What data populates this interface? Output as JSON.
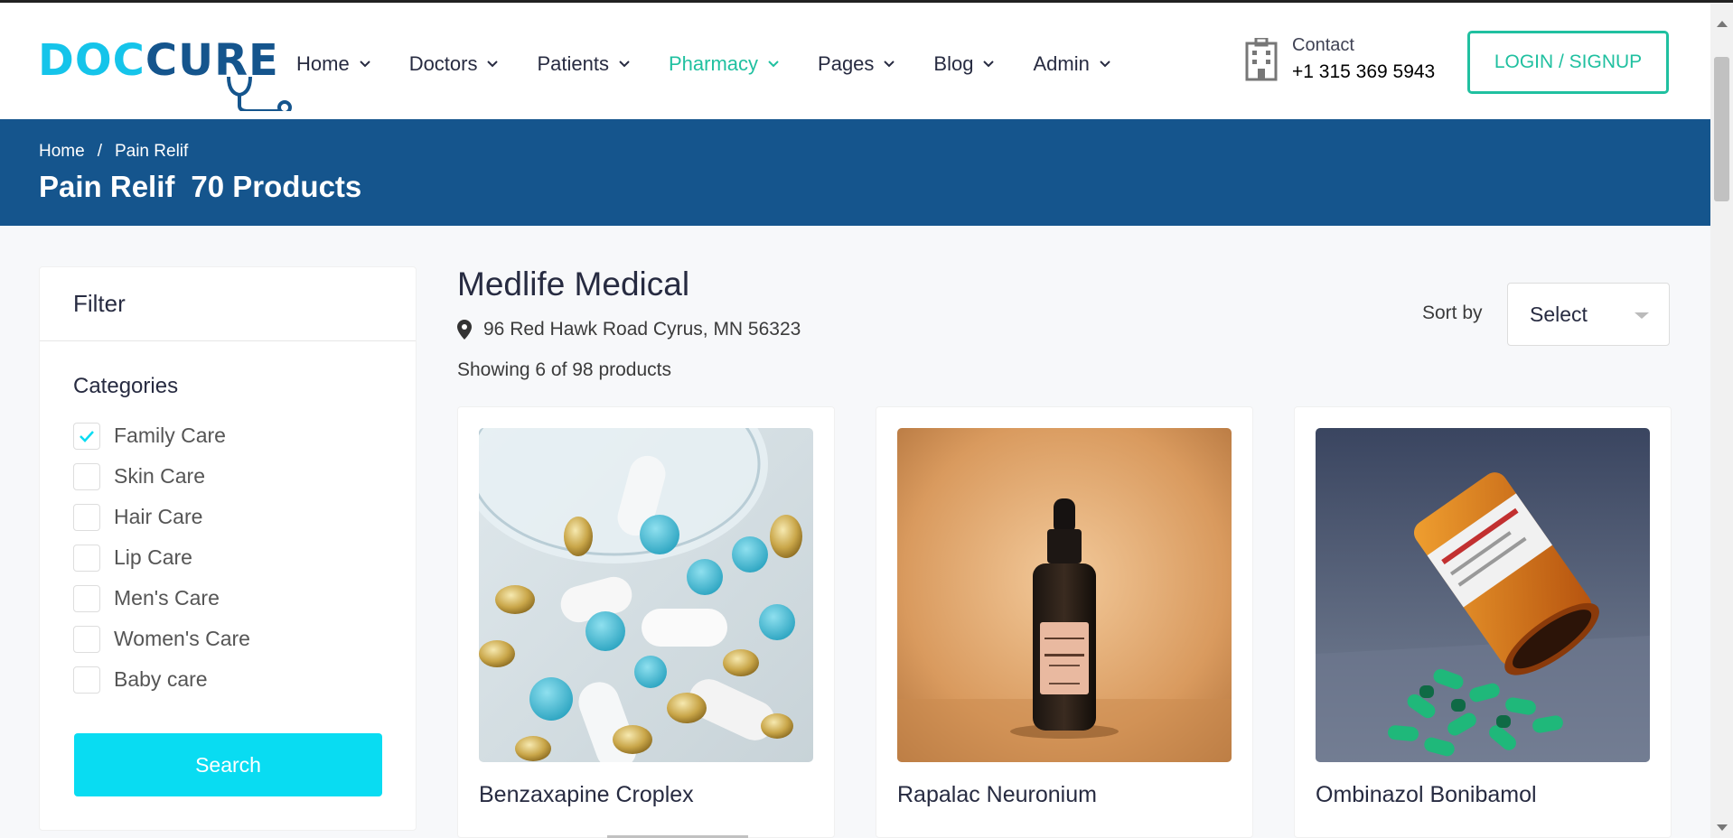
{
  "brand": {
    "logo_part1": "DOC",
    "logo_part2": "CURE"
  },
  "nav": [
    {
      "label": "Home",
      "active": false
    },
    {
      "label": "Doctors",
      "active": false
    },
    {
      "label": "Patients",
      "active": false
    },
    {
      "label": "Pharmacy",
      "active": true
    },
    {
      "label": "Pages",
      "active": false
    },
    {
      "label": "Blog",
      "active": false
    },
    {
      "label": "Admin",
      "active": false
    }
  ],
  "contact": {
    "label": "Contact",
    "phone": "+1 315 369 5943"
  },
  "login_label": "LOGIN / SIGNUP",
  "breadcrumb": {
    "home": "Home",
    "separator": "/",
    "current": "Pain Relif"
  },
  "page_title": {
    "name": "Pain Relif",
    "count": "70 Products"
  },
  "filter": {
    "title": "Filter",
    "categories_title": "Categories",
    "categories": [
      {
        "label": "Family Care",
        "checked": true
      },
      {
        "label": "Skin Care",
        "checked": false
      },
      {
        "label": "Hair Care",
        "checked": false
      },
      {
        "label": "Lip Care",
        "checked": false
      },
      {
        "label": "Men's Care",
        "checked": false
      },
      {
        "label": "Women's Care",
        "checked": false
      },
      {
        "label": "Baby care",
        "checked": false
      }
    ],
    "search_label": "Search"
  },
  "store": {
    "name": "Medlife Medical",
    "address": "96 Red Hawk Road Cyrus, MN 56323",
    "showing": "Showing 6 of 98 products"
  },
  "sort": {
    "label": "Sort by",
    "selected": "Select"
  },
  "products": [
    {
      "name": "Benzaxapine Croplex",
      "image": "pills-capsules-photo"
    },
    {
      "name": "Rapalac Neuronium",
      "image": "serum-bottle-photo"
    },
    {
      "name": "Ombinazol Bonibamol",
      "image": "spilled-pill-bottle-photo"
    }
  ],
  "colors": {
    "primary": "#15558d",
    "accent": "#20c0a0",
    "cyan": "#09dcf2"
  }
}
